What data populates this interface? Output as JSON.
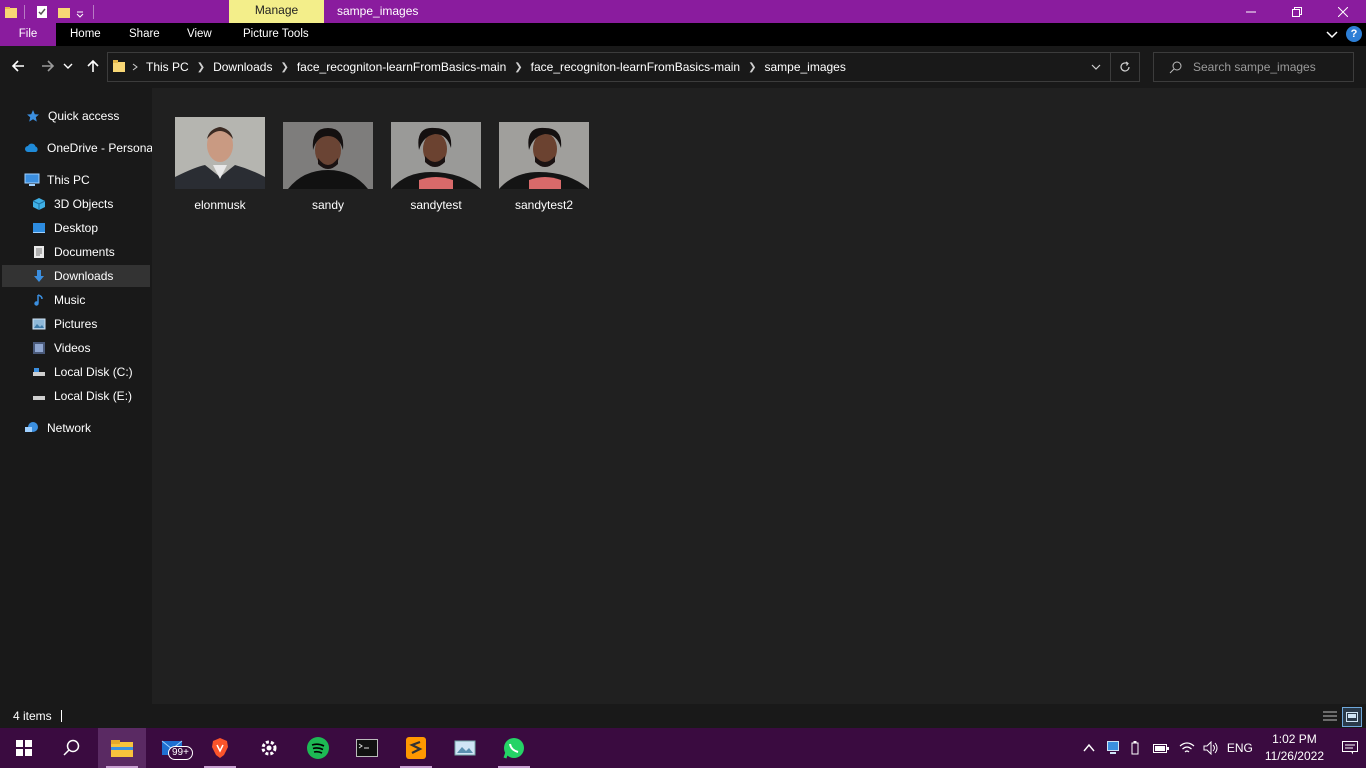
{
  "window": {
    "title": "sampe_images",
    "contextual_tab": "Manage",
    "controls": {
      "minimize_icon": "minimize-icon",
      "maximize_icon": "restore-icon",
      "close_icon": "close-icon"
    }
  },
  "ribbon": {
    "tabs": [
      {
        "label": "File"
      },
      {
        "label": "Home"
      },
      {
        "label": "Share"
      },
      {
        "label": "View"
      },
      {
        "label": "Picture Tools"
      }
    ],
    "help": "?"
  },
  "address_bar": {
    "crumbs": [
      "This PC",
      "Downloads",
      "face_recogniton-learnFromBasics-main",
      "face_recogniton-learnFromBasics-main",
      "sampe_images"
    ],
    "search_placeholder": "Search sampe_images"
  },
  "nav_pane": {
    "items": [
      {
        "label": "Quick access",
        "icon": "star-icon"
      },
      {
        "label": "OneDrive - Personal",
        "icon": "cloud-icon"
      },
      {
        "label": "This PC",
        "icon": "computer-icon"
      },
      {
        "label": "3D Objects",
        "icon": "cube-icon"
      },
      {
        "label": "Desktop",
        "icon": "desktop-icon"
      },
      {
        "label": "Documents",
        "icon": "document-icon"
      },
      {
        "label": "Downloads",
        "icon": "download-icon",
        "selected": true
      },
      {
        "label": "Music",
        "icon": "music-icon"
      },
      {
        "label": "Pictures",
        "icon": "pictures-icon"
      },
      {
        "label": "Videos",
        "icon": "video-icon"
      },
      {
        "label": "Local Disk (C:)",
        "icon": "disk-icon"
      },
      {
        "label": "Local Disk (E:)",
        "icon": "disk-icon"
      },
      {
        "label": "Network",
        "icon": "network-icon"
      }
    ]
  },
  "files": [
    {
      "name": "elonmusk"
    },
    {
      "name": "sandy"
    },
    {
      "name": "sandytest"
    },
    {
      "name": "sandytest2"
    }
  ],
  "status_bar": {
    "item_count": "4 items"
  },
  "taskbar": {
    "mail_badge": "99+",
    "tray": {
      "language": "ENG",
      "time": "1:02 PM",
      "date": "11/26/2022"
    }
  },
  "colors": {
    "accent": "#8a1c9e",
    "manage_tab": "#f3ee8a",
    "taskbar": "#3a0b40",
    "content_bg": "#202020"
  }
}
